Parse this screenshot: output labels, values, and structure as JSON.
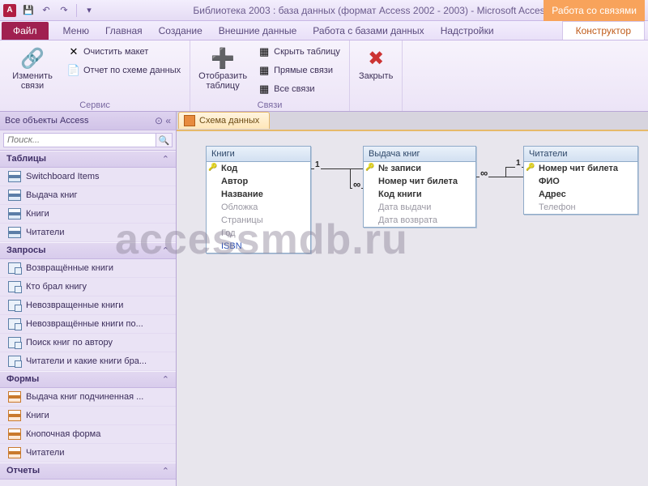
{
  "titlebar": {
    "access_badge": "A",
    "window_title": "Библиотека 2003 : база данных (формат Access 2002 - 2003)  -  Microsoft Access",
    "context_group": "Работа со связями"
  },
  "tabs": {
    "file": "Файл",
    "menu": "Меню",
    "home": "Главная",
    "create": "Создание",
    "external": "Внешние данные",
    "dbtools": "Работа с базами данных",
    "addins": "Надстройки",
    "designer": "Конструктор"
  },
  "ribbon": {
    "edit_rel": "Изменить связи",
    "clear_layout": "Очистить макет",
    "rel_report": "Отчет по схеме данных",
    "group_tools": "Сервис",
    "show_table": "Отобразить таблицу",
    "hide_table": "Скрыть таблицу",
    "direct_rel": "Прямые связи",
    "all_rel": "Все связи",
    "group_rel": "Связи",
    "close": "Закрыть"
  },
  "nav": {
    "header": "Все объекты Access",
    "search_placeholder": "Поиск...",
    "cat_tables": "Таблицы",
    "t1": "Switchboard Items",
    "t2": "Выдача книг",
    "t3": "Книги",
    "t4": "Читатели",
    "cat_queries": "Запросы",
    "q1": "Возвращённые книги",
    "q2": "Кто брал книгу",
    "q3": "Невозвращенные книги",
    "q4": "Невозвращённые книги по...",
    "q5": "Поиск книг по автору",
    "q6": "Читатели и какие книги бра...",
    "cat_forms": "Формы",
    "f1": "Выдача книг подчиненная ...",
    "f2": "Книги",
    "f3": "Кнопочная форма",
    "f4": "Читатели",
    "cat_reports": "Отчеты"
  },
  "doc": {
    "tab": "Схема данных"
  },
  "tables": {
    "books": {
      "title": "Книги",
      "fields": [
        "Код",
        "Автор",
        "Название",
        "Обложка",
        "Страницы",
        "Год",
        "ISBN"
      ]
    },
    "lending": {
      "title": "Выдача книг",
      "fields": [
        "№ записи",
        "Номер чит билета",
        "Код книги",
        "Дата выдачи",
        "Дата возврата"
      ]
    },
    "readers": {
      "title": "Читатели",
      "fields": [
        "Номер чит билета",
        "ФИО",
        "Адрес",
        "Телефон"
      ]
    }
  },
  "rel": {
    "one": "1",
    "many": "∞"
  },
  "watermark": "accessmdb.ru"
}
